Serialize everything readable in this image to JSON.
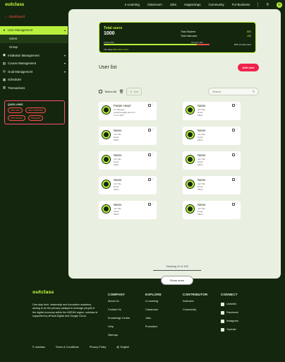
{
  "brand": {
    "logo": "outclass"
  },
  "topnav": {
    "links": [
      "e-Learning",
      "Classroom",
      "Jobs",
      "Happenings",
      "Community",
      "For Business"
    ]
  },
  "breadcrumb": {
    "back_label": "Dashboard"
  },
  "sidebar": {
    "items": [
      {
        "label": "User Management",
        "active": true
      },
      {
        "label": "Institution Management"
      },
      {
        "label": "Course Management"
      },
      {
        "label": "Goal Management"
      },
      {
        "label": "Scheduler"
      },
      {
        "label": "Transactions"
      }
    ],
    "subitems": [
      {
        "label": "Users",
        "active": true
      },
      {
        "label": "Group"
      }
    ]
  },
  "quicklinks": {
    "title": "QUICK LINKS",
    "pills": [
      "Add user",
      "Add Institution",
      "Add course",
      "Add goal"
    ]
  },
  "stats": {
    "title": "Total users",
    "total": "1000",
    "rows": [
      {
        "label": "Total Student",
        "value": "850"
      },
      {
        "label": "Total Instructor",
        "value": "150"
      }
    ],
    "bar_left_label": "Student 85%",
    "bar_right_label": "Instructor 15%",
    "student_fraction": 0.88,
    "pct_label": "85% of total users",
    "footer_prefix": "You have",
    "footer_highlight": "800 active users"
  },
  "userlist": {
    "title": "User list",
    "add_button": "Add user",
    "select_all": "Select All",
    "filter_label": "Sort",
    "search_placeholder": "Search",
    "cards": [
      {
        "name": "Potato Head",
        "line1": "Sr. Manager",
        "line2": "potatohead@email.com",
        "line3": "17-12-1947"
      },
      {
        "name": "Name",
        "line1": "Job Title",
        "line2": "Email",
        "line3": "KBLS"
      },
      {
        "name": "Name",
        "line1": "Job Title",
        "line2": "Email",
        "line3": "KBLS"
      },
      {
        "name": "Name",
        "line1": "Job Title",
        "line2": "Email",
        "line3": "KBLS"
      },
      {
        "name": "Name",
        "line1": "Job Title",
        "line2": "Email",
        "line3": "KBLS"
      },
      {
        "name": "Name",
        "line1": "Job Title",
        "line2": "Email",
        "line3": "KBLS"
      },
      {
        "name": "Name",
        "line1": "Job Title",
        "line2": "Email",
        "line3": "KBLS"
      },
      {
        "name": "Name",
        "line1": "Job Title",
        "line2": "Email",
        "line3": "KBLS"
      },
      {
        "name": "Name",
        "line1": "Job Title",
        "line2": "Email",
        "line3": "KBLS"
      },
      {
        "name": "Name",
        "line1": "Job Title",
        "line2": "Email",
        "line3": "KBLS"
      }
    ],
    "showing": "Showing 10 of 100",
    "show_more": "Show more"
  },
  "footer": {
    "logo": "outclass",
    "desc": "One-stop tech, leadership and innovation academy aiming to be the primary catalyst to leverage people in the digital economy within the ASEAN region. outclass is supported by aPasia Digital and Google Cloud.",
    "company": {
      "title": "COMPANY",
      "links": [
        "About Us",
        "Contact Us",
        "Knowledge Centre",
        "Help",
        "Sitemap"
      ]
    },
    "explore": {
      "title": "EXPLORE",
      "links": [
        "e-Learning",
        "Classroom",
        "Jobs",
        "Promotion"
      ]
    },
    "contributor": {
      "title": "CONTRIBUTOR",
      "links": [
        "Instructor",
        "Community"
      ]
    },
    "connect": {
      "title": "CONNECT",
      "links": [
        "LinkedIn",
        "Facebook",
        "Instagram",
        "Youtube"
      ]
    },
    "copyright": "© outclass",
    "terms": "Terms & Conditions",
    "privacy": "Privacy Policy",
    "language": "English"
  },
  "colors": {
    "dark": "#15260f",
    "lime": "#b8f03c",
    "accent": "#f0224c",
    "panel": "#eaf0e1"
  }
}
